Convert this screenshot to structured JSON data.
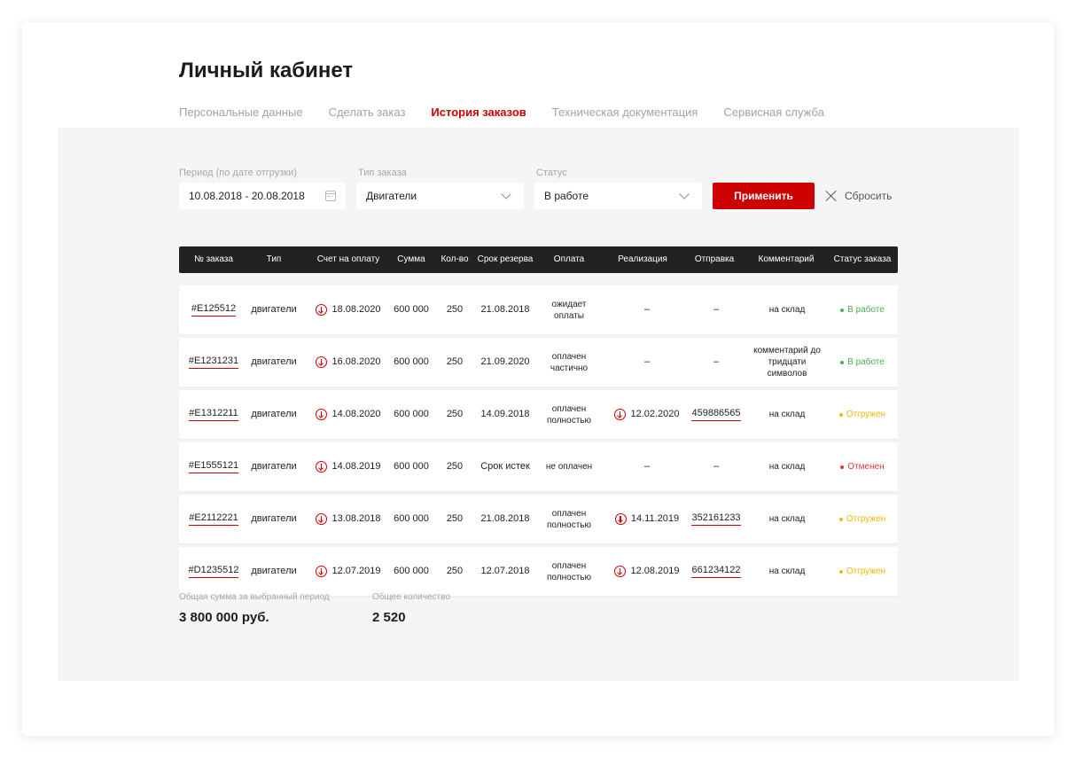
{
  "page_title": "Личный кабинет",
  "tabs": [
    {
      "label": "Персональные данные"
    },
    {
      "label": "Сделать заказ"
    },
    {
      "label": "История заказов"
    },
    {
      "label": "Техническая документация"
    },
    {
      "label": "Сервисная служба"
    }
  ],
  "active_tab": "История заказов",
  "filters": {
    "period": {
      "label": "Период (по дате отгрузки)",
      "value": "10.08.2018 - 20.08.2018",
      "icon": "calendar-icon"
    },
    "order_type": {
      "label": "Тип заказа",
      "value": "Двигатели",
      "icon": "chevron-down-icon"
    },
    "status": {
      "label": "Статус",
      "value": "В работе",
      "icon": "chevron-down-icon"
    },
    "apply_label": "Применить",
    "reset_label": "Сбросить"
  },
  "table": {
    "headers": {
      "number": "№ заказа",
      "type": "Тип",
      "invoice": "Счет на оплату",
      "sum": "Сумма",
      "qty": "Кол-во",
      "reserve": "Срок резерва",
      "payment": "Оплата",
      "realization": "Реализация",
      "shipment": "Отправка",
      "comment": "Комментарий",
      "status": "Статус заказа"
    },
    "rows": [
      {
        "number": "#E125512",
        "type": "двигатели",
        "invoice": "18.08.2020",
        "sum": "600 000",
        "qty": "250",
        "reserve": "21.08.2018",
        "payment": "ожидает оплаты",
        "realization": "–",
        "shipment": "–",
        "comment": "на склад",
        "status": "В работе",
        "status_color": "#4caf50"
      },
      {
        "number": "#E1231231",
        "type": "двигатели",
        "invoice": "16.08.2020",
        "sum": "600 000",
        "qty": "250",
        "reserve": "21.09.2020",
        "payment": "оплачен частично",
        "realization": "–",
        "shipment": "–",
        "comment": "комментарий до тридцати символов",
        "status": "В работе",
        "status_color": "#4caf50"
      },
      {
        "number": "#E1312211",
        "type": "двигатели",
        "invoice": "14.08.2020",
        "sum": "600 000",
        "qty": "250",
        "reserve": "14.09.2018",
        "payment": "оплачен полностью",
        "realization": "12.02.2020",
        "shipment": "459886565",
        "comment": "на склад",
        "status": "Отгружен",
        "status_color": "#f2b705"
      },
      {
        "number": "#E1555121",
        "type": "двигатели",
        "invoice": "14.08.2019",
        "sum": "600 000",
        "qty": "250",
        "reserve": "Срок истек",
        "payment": "не оплачен",
        "realization": "–",
        "shipment": "–",
        "comment": "на склад",
        "status": "Отменен",
        "status_color": "#e53935"
      },
      {
        "number": "#E2112221",
        "type": "двигатели",
        "invoice": "13.08.2018",
        "sum": "600 000",
        "qty": "250",
        "reserve": "21.08.2018",
        "payment": "оплачен полностью",
        "realization": "14.11.2019",
        "shipment": "352161233",
        "comment": "на склад",
        "status": "Отгружен",
        "status_color": "#f2b705"
      },
      {
        "number": "#D1235512",
        "type": "двигатели",
        "invoice": "12.07.2019",
        "sum": "600 000",
        "qty": "250",
        "reserve": "12.07.2018",
        "payment": "оплачен полностью",
        "realization": "12.08.2019",
        "shipment": "661234122",
        "comment": "на склад",
        "status": "Отгружен",
        "status_color": "#f2b705"
      }
    ]
  },
  "totals": {
    "sum_label": "Общая сумма за выбранный период",
    "sum_value": "3 800 000 руб.",
    "qty_label": "Общее количество",
    "qty_value": "2 520"
  },
  "colors": {
    "accent": "#cc0000",
    "header_bg": "#222222",
    "panel_bg": "#f5f5f5",
    "status_in_work": "#4caf50",
    "status_shipped": "#f2b705",
    "status_cancelled": "#e53935"
  }
}
